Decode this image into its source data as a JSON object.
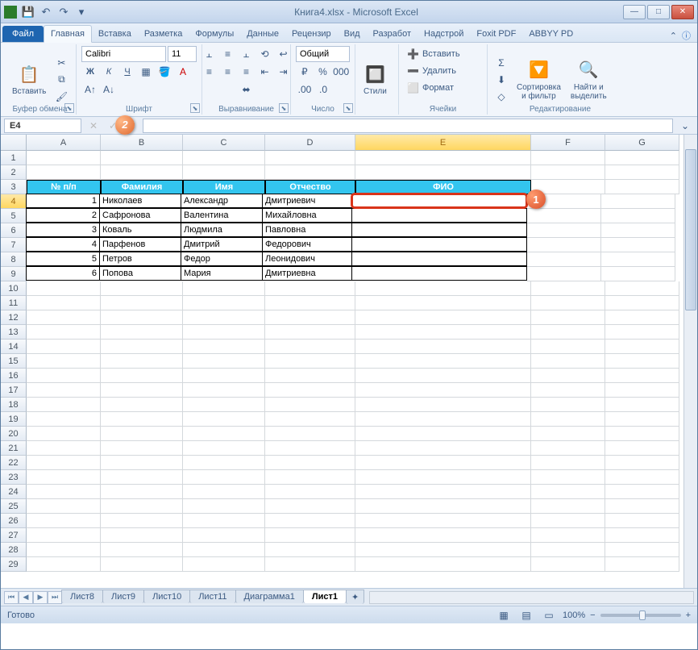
{
  "window": {
    "title": "Книга4.xlsx - Microsoft Excel"
  },
  "qat": {
    "save": "💾",
    "undo": "↶",
    "redo": "↷"
  },
  "tabs": {
    "file": "Файл",
    "items": [
      "Главная",
      "Вставка",
      "Разметка",
      "Формулы",
      "Данные",
      "Рецензир",
      "Вид",
      "Разработ",
      "Надстрой",
      "Foxit PDF",
      "ABBYY PD"
    ],
    "active": 0
  },
  "ribbon": {
    "clipboard": {
      "label": "Буфер обмена",
      "paste": "Вставить"
    },
    "font": {
      "label": "Шрифт",
      "name": "Calibri",
      "size": "11"
    },
    "align": {
      "label": "Выравнивание"
    },
    "number": {
      "label": "Число",
      "format": "Общий"
    },
    "styles": {
      "label": "Стили",
      "btn": "Стили"
    },
    "cells": {
      "label": "Ячейки",
      "insert": "Вставить",
      "delete": "Удалить",
      "format": "Формат"
    },
    "editing": {
      "label": "Редактирование",
      "sort": "Сортировка\nи фильтр",
      "find": "Найти и\nвыделить"
    }
  },
  "nameBox": "E4",
  "columns": [
    "A",
    "B",
    "C",
    "D",
    "E",
    "F",
    "G"
  ],
  "table": {
    "headers": {
      "n": "№ п/п",
      "f": "Фамилия",
      "i": "Имя",
      "o": "Отчество",
      "fio": "ФИО"
    },
    "rows": [
      {
        "n": "1",
        "f": "Николаев",
        "i": "Александр",
        "o": "Дмитриевич"
      },
      {
        "n": "2",
        "f": "Сафронова",
        "i": "Валентина",
        "o": "Михайловна"
      },
      {
        "n": "3",
        "f": "Коваль",
        "i": "Людмила",
        "o": "Павловна"
      },
      {
        "n": "4",
        "f": "Парфенов",
        "i": "Дмитрий",
        "o": "Федорович"
      },
      {
        "n": "5",
        "f": "Петров",
        "i": "Федор",
        "o": "Леонидович"
      },
      {
        "n": "6",
        "f": "Попова",
        "i": "Мария",
        "o": "Дмитриевна"
      }
    ]
  },
  "sheets": {
    "items": [
      "Лист8",
      "Лист9",
      "Лист10",
      "Лист11",
      "Диаграмма1",
      "Лист1"
    ],
    "active": 5
  },
  "status": {
    "ready": "Готово",
    "zoom": "100%"
  },
  "callouts": {
    "one": "1",
    "two": "2"
  }
}
